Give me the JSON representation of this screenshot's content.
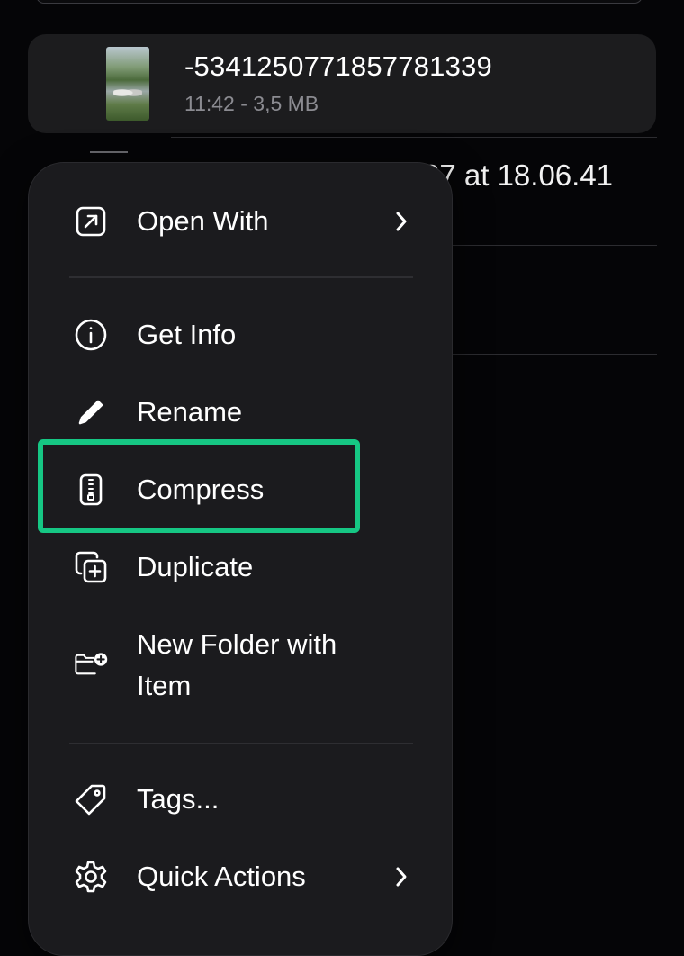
{
  "file_row": {
    "name": "-5341250771857781339",
    "meta": "11:42 - 3,5 MB"
  },
  "background_row": {
    "partial_text": "27 at 18.06.41"
  },
  "menu": {
    "items": [
      {
        "label": "Open With",
        "icon": "open-with-icon",
        "has_submenu": true
      },
      {
        "label": "Get Info",
        "icon": "info-icon",
        "has_submenu": false
      },
      {
        "label": "Rename",
        "icon": "pencil-icon",
        "has_submenu": false
      },
      {
        "label": "Compress",
        "icon": "zip-archive-icon",
        "has_submenu": false,
        "highlighted": true
      },
      {
        "label": "Duplicate",
        "icon": "duplicate-icon",
        "has_submenu": false
      },
      {
        "label": "New Folder with Item",
        "icon": "new-folder-icon",
        "has_submenu": false
      },
      {
        "label": "Tags...",
        "icon": "tag-icon",
        "has_submenu": false
      },
      {
        "label": "Quick Actions",
        "icon": "gear-icon",
        "has_submenu": true
      }
    ]
  },
  "colors": {
    "highlight": "#16c784",
    "menu_bg": "#1b1b1e",
    "row_bg": "#1c1c1e"
  }
}
